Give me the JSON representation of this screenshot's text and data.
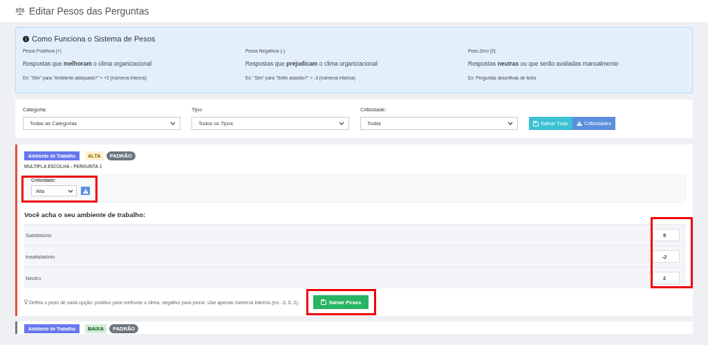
{
  "header": {
    "title": "Editar Pesos das Perguntas"
  },
  "info_panel": {
    "title": "Como Funciona o Sistema de Pesos",
    "columns": [
      {
        "label": "Pesos Positivos (+)",
        "text": "Respostas que **melhoram** o clima organizacional",
        "example": "Ex: \"Sim\" para \"Ambiente adequado?\" = +2 (números inteiros)"
      },
      {
        "label": "Pesos Negativos (-)",
        "text": "Respostas que **prejudicam** o clima organizacional",
        "example": "Ex: \"Sim\" para \"Sofre assédio?\" = -3 (números inteiros)"
      },
      {
        "label": "Peso Zero (0)",
        "text": "Respostas **neutras** ou que serão avaliadas manualmente",
        "example": "Ex: Perguntas descritivas de texto"
      }
    ]
  },
  "filters": [
    {
      "label": "Categoria:",
      "value": "Todas as Categorias"
    },
    {
      "label": "Tipo:",
      "value": "Todos os Tipos"
    },
    {
      "label": "Criticidade:",
      "value": "Todas"
    }
  ],
  "buttons": [
    {
      "kind": "save",
      "label": "Salvar Tudo"
    },
    {
      "kind": "criticality",
      "label": "Criticidades"
    }
  ],
  "cards": [
    {
      "category": "Ambiente de Trabalho",
      "priority": "ALTA",
      "high_priority": true,
      "standard": "PADRÃO",
      "subtitle": "MULTIPLA ESCOLHA - PERGUNTA 1",
      "criticality_label": "Criticidade:",
      "criticality_value": "Alta",
      "criticality_highlighted": true,
      "question": "Você acha o seu ambiente de trabalho:",
      "options": [
        {
          "label": "Satisfatório",
          "weight": "5"
        },
        {
          "label": "Insatisfatório",
          "weight": "-2"
        },
        {
          "label": "Neutro",
          "weight": "2"
        }
      ],
      "weights_highlighted": true,
      "hint": "Defina o peso de cada opção: positivo para melhorar o clima, negativo para piorar. Use apenas números inteiros (ex: -3, 0, 2).",
      "save_label": "Salvar Pesos",
      "save_highlighted": true
    },
    {
      "category": "Ambiente de Trabalho",
      "priority": "BAIXA",
      "high_priority": false,
      "standard": "PADRÃO"
    }
  ]
}
